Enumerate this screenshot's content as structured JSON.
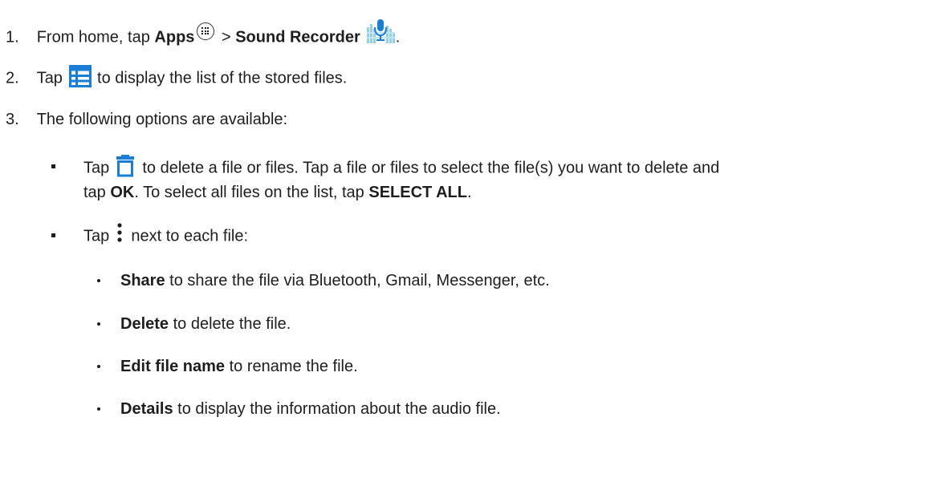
{
  "steps": [
    {
      "number": "1.",
      "text_before": "From home, tap ",
      "bold_apps": "Apps",
      "separator": " > ",
      "bold_app": "Sound Recorder",
      "text_after": "."
    },
    {
      "number": "2.",
      "text_before": "Tap ",
      "text_after": " to display the list of the stored files."
    },
    {
      "number": "3.",
      "text": "The following options are available:"
    }
  ],
  "options": [
    {
      "text_before": "Tap ",
      "text_after": " to delete a file or files. Tap a file or files to select the file(s) you want to delete and",
      "line2_before": "tap ",
      "bold_ok": "OK",
      "line2_mid": ". To select all files on the list, tap ",
      "bold_select_all": "SELECT ALL",
      "line2_after": "."
    },
    {
      "text_before": "Tap ",
      "text_after": " next to each file:"
    }
  ],
  "menu_items": [
    {
      "bold": "Share",
      "text": " to share the file via Bluetooth, Gmail, Messenger, etc."
    },
    {
      "bold": "Delete",
      "text": " to delete the file."
    },
    {
      "bold": "Edit file name",
      "text": " to rename the file."
    },
    {
      "bold": "Details",
      "text": " to display the information about the audio file."
    }
  ],
  "icons": {
    "apps": "apps-grid-icon",
    "sound_recorder": "sound-recorder-icon",
    "list": "file-list-icon",
    "delete": "trash-icon",
    "more": "more-options-icon"
  },
  "colors": {
    "text": "#1e1e1e",
    "icon_blue": "#1a7fd4",
    "recorder_bg": "#8fd0ef"
  }
}
